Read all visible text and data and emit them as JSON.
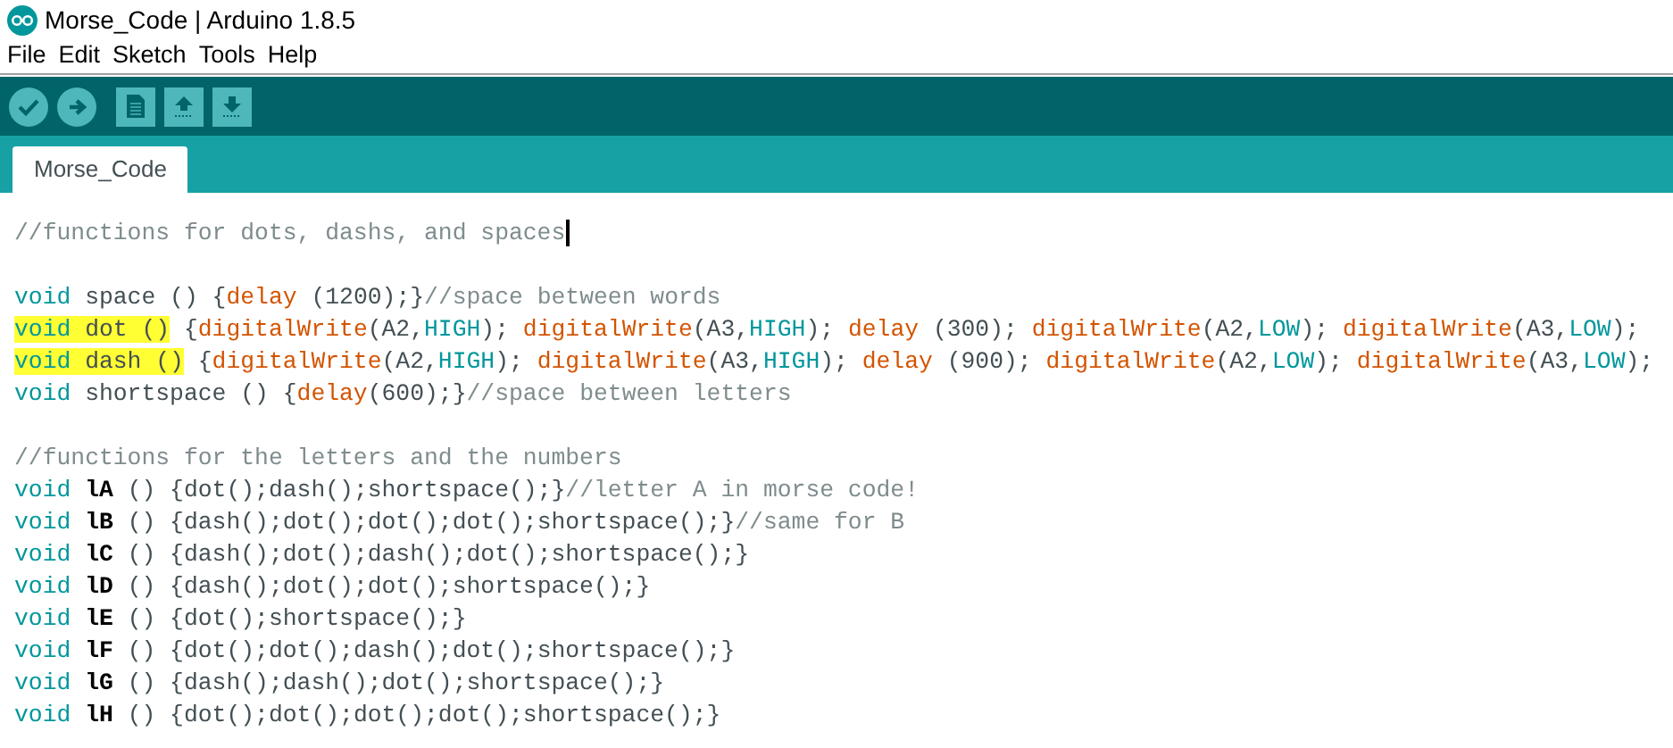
{
  "window": {
    "title": "Morse_Code | Arduino 1.8.5"
  },
  "menu": [
    "File",
    "Edit",
    "Sketch",
    "Tools",
    "Help"
  ],
  "toolbar": [
    {
      "kind": "round"
    },
    {
      "kind": "round"
    },
    {
      "kind": "square"
    },
    {
      "kind": "square"
    },
    {
      "kind": "square"
    }
  ],
  "tabs": [
    {
      "label": "Morse_Code",
      "selected": true
    }
  ],
  "editor": {
    "lines": [
      {
        "kind": "code",
        "text": "//functions for dots, dashs, and spaces",
        "highlighted": false,
        "cursor": true
      },
      {
        "kind": "blank"
      },
      {
        "kind": "code",
        "text": "void space () {delay (1200);}//space between words",
        "highlighted": false,
        "cursor": false
      },
      {
        "kind": "code",
        "text": "void dot () {digitalWrite(A2,HIGH); digitalWrite(A3,HIGH); delay (300); digitalWrite(A2,LOW); digitalWrite(A3,LOW);",
        "highlighted": true,
        "cursor": false
      },
      {
        "kind": "code",
        "text": "void dash () {digitalWrite(A2,HIGH); digitalWrite(A3,HIGH); delay (900); digitalWrite(A2,LOW); digitalWrite(A3,LOW);",
        "highlighted": true,
        "cursor": false
      },
      {
        "kind": "code",
        "text": "void shortspace () {delay(600);}//space between letters",
        "highlighted": false,
        "cursor": false
      },
      {
        "kind": "blank"
      },
      {
        "kind": "code",
        "text": "//functions for the letters and the numbers",
        "highlighted": false,
        "cursor": false
      },
      {
        "kind": "code",
        "text": "void lA () {dot();dash();shortspace();}//letter A in morse code!",
        "highlighted": false,
        "cursor": false
      },
      {
        "kind": "code",
        "text": "void lB () {dash();dot();dot();dot();shortspace();}//same for B",
        "highlighted": false,
        "cursor": false
      },
      {
        "kind": "code",
        "text": "void lC () {dash();dot();dash();dot();shortspace();}",
        "highlighted": false,
        "cursor": false
      },
      {
        "kind": "code",
        "text": "void lD () {dash();dot();dot();shortspace();}",
        "highlighted": false,
        "cursor": false
      },
      {
        "kind": "code",
        "text": "void lE () {dot();shortspace();}",
        "highlighted": false,
        "cursor": false
      },
      {
        "kind": "code",
        "text": "void lF () {dot();dot();dash();dot();shortspace();}",
        "highlighted": false,
        "cursor": false
      },
      {
        "kind": "code",
        "text": "void lG () {dash();dash();dot();shortspace();}",
        "highlighted": false,
        "cursor": false
      },
      {
        "kind": "code",
        "text": "void lH () {dot();dot();dot();dot();shortspace();}",
        "highlighted": false,
        "cursor": false
      }
    ]
  }
}
